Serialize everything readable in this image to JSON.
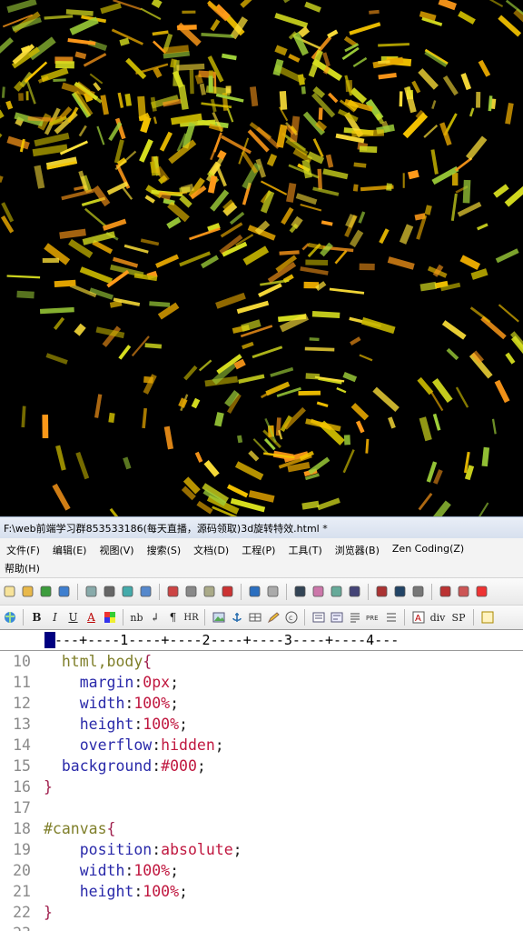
{
  "window": {
    "title": "F:\\web前端学习群853533186(每天直播，源码领取)3d旋转特效.html *"
  },
  "menu": {
    "items": [
      "文件(F)",
      "编辑(E)",
      "视图(V)",
      "搜索(S)",
      "文档(D)",
      "工程(P)",
      "工具(T)",
      "浏览器(B)",
      "Zen Coding(Z)"
    ],
    "help": "帮助(H)"
  },
  "toolbar": {
    "row1_icons": [
      "new-file-icon",
      "open-folder-icon",
      "save-icon",
      "save-all-icon",
      "print-preview-icon",
      "print-icon",
      "spellcheck-icon",
      "browser-preview-icon",
      "cut-icon",
      "copy-icon",
      "paste-icon",
      "delete-icon",
      "undo-icon",
      "redo-icon",
      "find-icon",
      "replace-icon",
      "find-in-files-icon",
      "indent-icon",
      "font-size-icon",
      "heading-icon",
      "wrap-icon",
      "line-numbers-icon",
      "column-icon",
      "check-icon"
    ],
    "row2_labels": {
      "bold": "B",
      "italic": "I",
      "underline": "U",
      "font_color": "A",
      "nbsp": "nb",
      "br": "↲",
      "para": "¶",
      "hr": "HR",
      "div": "div",
      "span": "SP"
    }
  },
  "ruler": {
    "text": "---+----1----+----2----+----3----+----4---"
  },
  "editor": {
    "lines": [
      {
        "num": "10",
        "indent": "  ",
        "tokens": [
          {
            "c": "sel",
            "t": "html,body"
          },
          {
            "c": "brace",
            "t": "{"
          }
        ]
      },
      {
        "num": "11",
        "indent": "    ",
        "tokens": [
          {
            "c": "prop",
            "t": "margin"
          },
          {
            "c": "pun",
            "t": ":"
          },
          {
            "c": "val",
            "t": "0px"
          },
          {
            "c": "pun",
            "t": ";"
          }
        ]
      },
      {
        "num": "12",
        "indent": "    ",
        "tokens": [
          {
            "c": "prop",
            "t": "width"
          },
          {
            "c": "pun",
            "t": ":"
          },
          {
            "c": "val",
            "t": "100%"
          },
          {
            "c": "pun",
            "t": ";"
          }
        ]
      },
      {
        "num": "13",
        "indent": "    ",
        "tokens": [
          {
            "c": "prop",
            "t": "height"
          },
          {
            "c": "pun",
            "t": ":"
          },
          {
            "c": "val",
            "t": "100%"
          },
          {
            "c": "pun",
            "t": ";"
          }
        ]
      },
      {
        "num": "14",
        "indent": "    ",
        "tokens": [
          {
            "c": "prop",
            "t": "overflow"
          },
          {
            "c": "pun",
            "t": ":"
          },
          {
            "c": "val",
            "t": "hidden"
          },
          {
            "c": "pun",
            "t": ";"
          }
        ]
      },
      {
        "num": "15",
        "indent": "  ",
        "tokens": [
          {
            "c": "prop",
            "t": "background"
          },
          {
            "c": "pun",
            "t": ":"
          },
          {
            "c": "val",
            "t": "#000"
          },
          {
            "c": "pun",
            "t": ";"
          }
        ]
      },
      {
        "num": "16",
        "indent": "",
        "tokens": [
          {
            "c": "brace",
            "t": "}"
          }
        ]
      },
      {
        "num": "17",
        "indent": "",
        "tokens": []
      },
      {
        "num": "18",
        "indent": "",
        "tokens": [
          {
            "c": "sel",
            "t": "#canvas"
          },
          {
            "c": "brace",
            "t": "{"
          }
        ]
      },
      {
        "num": "19",
        "indent": "    ",
        "tokens": [
          {
            "c": "prop",
            "t": "position"
          },
          {
            "c": "pun",
            "t": ":"
          },
          {
            "c": "val",
            "t": "absolute"
          },
          {
            "c": "pun",
            "t": ";"
          }
        ]
      },
      {
        "num": "20",
        "indent": "    ",
        "tokens": [
          {
            "c": "prop",
            "t": "width"
          },
          {
            "c": "pun",
            "t": ":"
          },
          {
            "c": "val",
            "t": "100%"
          },
          {
            "c": "pun",
            "t": ";"
          }
        ]
      },
      {
        "num": "21",
        "indent": "    ",
        "tokens": [
          {
            "c": "prop",
            "t": "height"
          },
          {
            "c": "pun",
            "t": ":"
          },
          {
            "c": "val",
            "t": "100%"
          },
          {
            "c": "pun",
            "t": ";"
          }
        ]
      },
      {
        "num": "22",
        "indent": "",
        "tokens": [
          {
            "c": "brace",
            "t": "}"
          }
        ]
      },
      {
        "num": "23",
        "indent": "",
        "tokens": []
      }
    ]
  },
  "colors": {
    "selector": "#7f7f2a",
    "property": "#2a2aaa",
    "value": "#c0173f",
    "line_number": "#8a8a8a",
    "ruler_cursor": "#000080"
  }
}
